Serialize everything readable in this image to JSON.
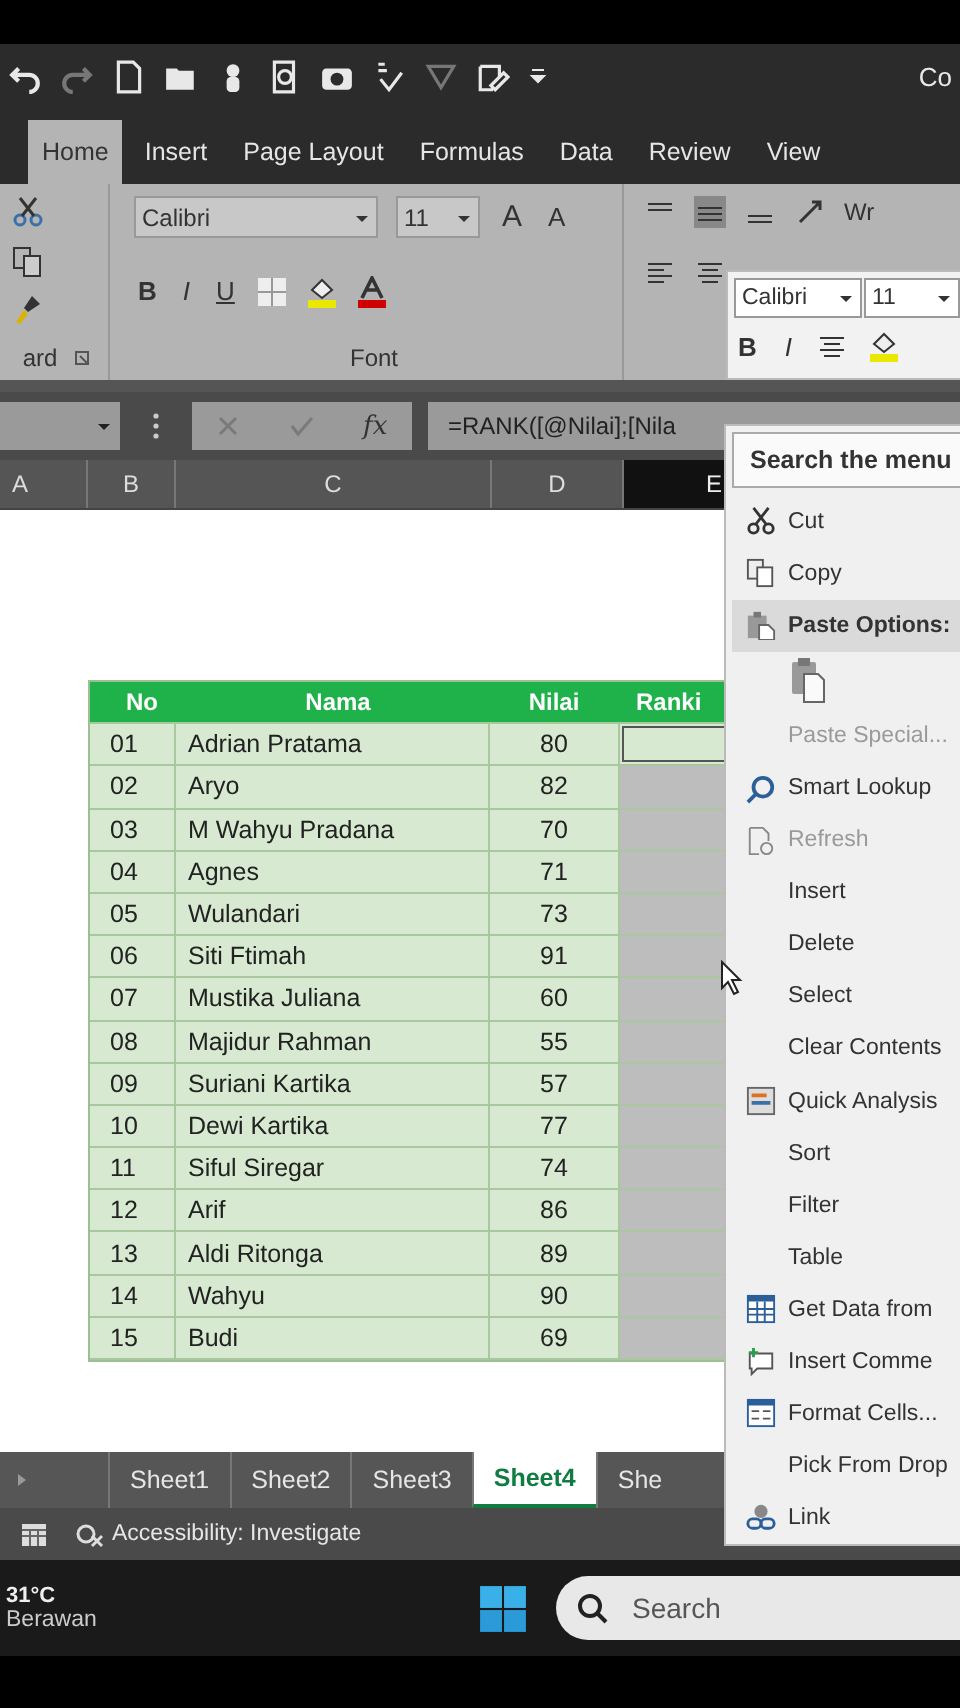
{
  "title_fragment": "Co",
  "ribbon_tabs": [
    {
      "label": "Home",
      "selected": true
    },
    {
      "label": "Insert",
      "selected": false
    },
    {
      "label": "Page Layout",
      "selected": false
    },
    {
      "label": "Formulas",
      "selected": false
    },
    {
      "label": "Data",
      "selected": false
    },
    {
      "label": "Review",
      "selected": false
    },
    {
      "label": "View",
      "selected": false
    }
  ],
  "ribbon": {
    "clipboard_label": "ard",
    "font_name": "Calibri",
    "font_size": "11",
    "grow_font": "A",
    "shrink_font": "A",
    "format_buttons": [
      "B",
      "I",
      "U"
    ],
    "font_label": "Font",
    "wrap_fragment": "Wr"
  },
  "formula_bar": {
    "fx": "fx",
    "formula": "=RANK([@Nilai];[Nila"
  },
  "column_headers": [
    {
      "label": "A",
      "selected": false
    },
    {
      "label": "B",
      "selected": false
    },
    {
      "label": "C",
      "selected": false
    },
    {
      "label": "D",
      "selected": false
    },
    {
      "label": "E",
      "selected": true
    }
  ],
  "table": {
    "columns": [
      "No",
      "Nama",
      "Nilai",
      "Ranki"
    ],
    "ranking_selected": true,
    "rows": [
      {
        "no": "01",
        "name": "Adrian Pratama",
        "nilai": "80"
      },
      {
        "no": "02",
        "name": "Aryo",
        "nilai": "82"
      },
      {
        "no": "03",
        "name": "M Wahyu Pradana",
        "nilai": "70"
      },
      {
        "no": "04",
        "name": "Agnes",
        "nilai": "71"
      },
      {
        "no": "05",
        "name": "Wulandari",
        "nilai": "73"
      },
      {
        "no": "06",
        "name": "Siti Ftimah",
        "nilai": "91"
      },
      {
        "no": "07",
        "name": "Mustika Juliana",
        "nilai": "60"
      },
      {
        "no": "08",
        "name": "Majidur Rahman",
        "nilai": "55"
      },
      {
        "no": "09",
        "name": "Suriani Kartika",
        "nilai": "57"
      },
      {
        "no": "10",
        "name": "Dewi Kartika",
        "nilai": "77"
      },
      {
        "no": "11",
        "name": "Siful Siregar",
        "nilai": "74"
      },
      {
        "no": "12",
        "name": "Arif",
        "nilai": "86"
      },
      {
        "no": "13",
        "name": "Aldi Ritonga",
        "nilai": "89"
      },
      {
        "no": "14",
        "name": "Wahyu",
        "nilai": "90"
      },
      {
        "no": "15",
        "name": "Budi",
        "nilai": "69"
      }
    ]
  },
  "mini_toolbar": {
    "font_name": "Calibri",
    "font_size": "11",
    "bold": "B",
    "italic": "I"
  },
  "context_menu": {
    "search_placeholder": "Search the menu",
    "items": [
      {
        "label": "Cut",
        "kind": "item",
        "disabled": false
      },
      {
        "label": "Copy",
        "kind": "item",
        "disabled": false
      },
      {
        "label": "Paste Options:",
        "kind": "header",
        "disabled": false
      },
      {
        "kind": "paste-icons"
      },
      {
        "label": "Paste Special...",
        "kind": "item",
        "disabled": true
      },
      {
        "label": "Smart Lookup",
        "kind": "item",
        "disabled": false
      },
      {
        "label": "Refresh",
        "kind": "item",
        "disabled": true
      },
      {
        "label": "Insert",
        "kind": "item",
        "disabled": false
      },
      {
        "label": "Delete",
        "kind": "item",
        "disabled": false
      },
      {
        "label": "Select",
        "kind": "item",
        "disabled": false
      },
      {
        "label": "Clear Contents",
        "kind": "item",
        "disabled": false
      },
      {
        "label": "Quick Analysis",
        "kind": "item",
        "disabled": false
      },
      {
        "label": "Sort",
        "kind": "item",
        "disabled": false
      },
      {
        "label": "Filter",
        "kind": "item",
        "disabled": false
      },
      {
        "label": "Table",
        "kind": "item",
        "disabled": false
      },
      {
        "label": "Get Data from",
        "kind": "item",
        "disabled": false
      },
      {
        "label": "Insert Comme",
        "kind": "item",
        "disabled": false
      },
      {
        "label": "Format Cells...",
        "kind": "item",
        "disabled": false
      },
      {
        "label": "Pick From Drop",
        "kind": "item",
        "disabled": false
      },
      {
        "label": "Link",
        "kind": "item",
        "disabled": false
      }
    ]
  },
  "sheet_tabs": [
    {
      "label": "Sheet1",
      "selected": false
    },
    {
      "label": "Sheet2",
      "selected": false
    },
    {
      "label": "Sheet3",
      "selected": false
    },
    {
      "label": "Sheet4",
      "selected": true
    },
    {
      "label": "She",
      "selected": false
    }
  ],
  "status_bar": {
    "accessibility": "Accessibility: Investigate"
  },
  "taskbar": {
    "temperature": "31°C",
    "weather": "Berawan",
    "search_placeholder": "Search"
  }
}
